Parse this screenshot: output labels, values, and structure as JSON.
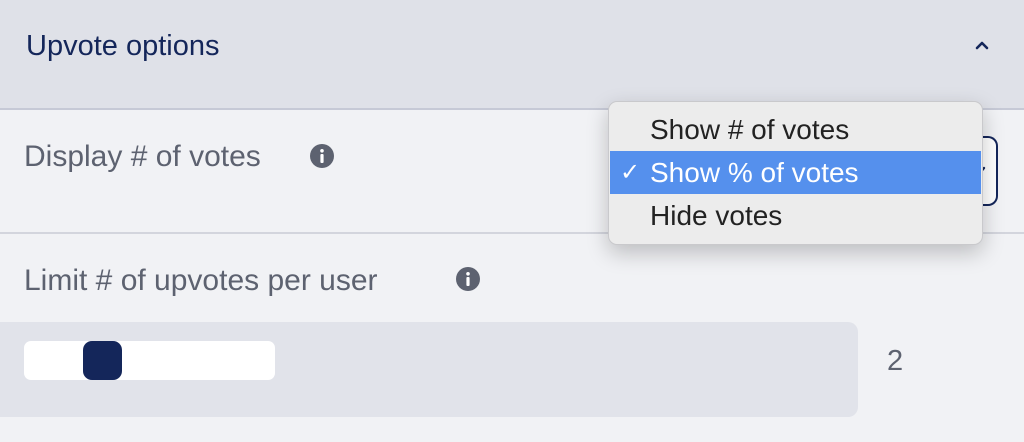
{
  "section": {
    "title": "Upvote options",
    "toggle_icon": "chevron-up-icon"
  },
  "display_votes": {
    "label": "Display # of votes",
    "info_icon": "info-icon",
    "selected_value": "Show % of votes",
    "options": [
      {
        "label": "Show # of votes",
        "selected": false
      },
      {
        "label": "Show % of votes",
        "selected": true
      },
      {
        "label": "Hide votes",
        "selected": false
      }
    ],
    "check_glyph": "✓"
  },
  "limit_upvotes": {
    "label": "Limit # of upvotes per user",
    "info_icon": "info-icon",
    "value": "2",
    "slider_fraction": 0.31
  },
  "colors": {
    "accent": "#14265a",
    "selected_option": "#5590ed",
    "header_bg": "#dfe1e8"
  }
}
